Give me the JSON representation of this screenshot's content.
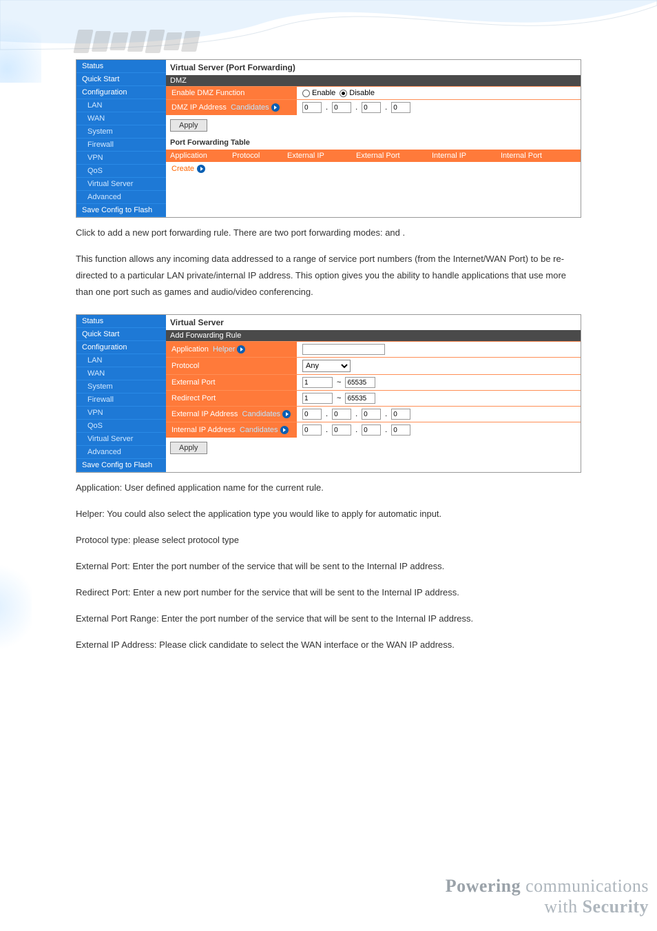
{
  "logo_alt": "BILLION",
  "nav1": [
    "Status",
    "Quick Start",
    "Configuration"
  ],
  "nav1_sub": [
    "LAN",
    "WAN",
    "System",
    "Firewall",
    "VPN",
    "QoS",
    "Virtual Server",
    "Advanced"
  ],
  "nav1_last": "Save Config to Flash",
  "pane1": {
    "title": "Virtual Server (Port Forwarding)",
    "section": "DMZ",
    "r1_label": "Enable DMZ Function",
    "r1_enable": "Enable",
    "r1_disable": "Disable",
    "r2_label": "DMZ IP Address",
    "r2_cand": "Candidates",
    "ip": [
      "0",
      "0",
      "0",
      "0"
    ],
    "apply": "Apply",
    "pft_header": "Port Forwarding Table",
    "cols": [
      "Application",
      "Protocol",
      "External IP",
      "External Port",
      "Internal IP",
      "Internal Port"
    ],
    "create": "Create"
  },
  "para1a": "Click ",
  "para1b": " to add a new port forwarding rule. There are two port forwarding modes: ",
  "para1c": " and ",
  "para1d": ".",
  "para2": "This function allows any incoming data addressed to a range of service port numbers (from the Internet/WAN Port) to be re-directed to a particular LAN private/internal IP address. This option gives you the ability to handle applications that use more than one port such as games and audio/video conferencing.",
  "nav2": [
    "Status",
    "Quick Start",
    "Configuration"
  ],
  "nav2_sub": [
    "LAN",
    "WAN",
    "System",
    "Firewall",
    "VPN",
    "QoS",
    "Virtual Server",
    "Advanced"
  ],
  "nav2_last": "Save Config to Flash",
  "pane2": {
    "title": "Virtual Server",
    "section": "Add Forwarding Rule",
    "app_label": "Application",
    "helper": "Helper",
    "proto_label": "Protocol",
    "proto_value": "Any",
    "ext_port_label": "External Port",
    "ext_port_from": "1",
    "ext_port_to": "65535",
    "red_port_label": "Redirect Port",
    "red_port_from": "1",
    "red_port_to": "65535",
    "ext_ip_label": "External IP Address",
    "int_ip_label": "Internal IP Address",
    "cand": "Candidates",
    "ext_ip": [
      "0",
      "0",
      "0",
      "0"
    ],
    "int_ip": [
      "0",
      "0",
      "0",
      "0"
    ],
    "apply": "Apply"
  },
  "b1": "Application: User defined application name for the current rule.",
  "b2": "Helper: You could also select the application type you would like to apply for automatic input.",
  "b3": "Protocol type: please select protocol type",
  "b4": "External Port: Enter the port number of the service that will be sent to the Internal IP address.",
  "b5": "Redirect Port: Enter a new port number for the service that will be sent to the Internal IP address.",
  "b6": "External Port Range: Enter the port number of the service that will be sent to the Internal IP address.",
  "b7": "External IP Address: Please click candidate to select the WAN interface or the WAN IP address.",
  "footer1a": "Powering",
  "footer1b": " communications",
  "footer2a": "with ",
  "footer2b": "Security"
}
